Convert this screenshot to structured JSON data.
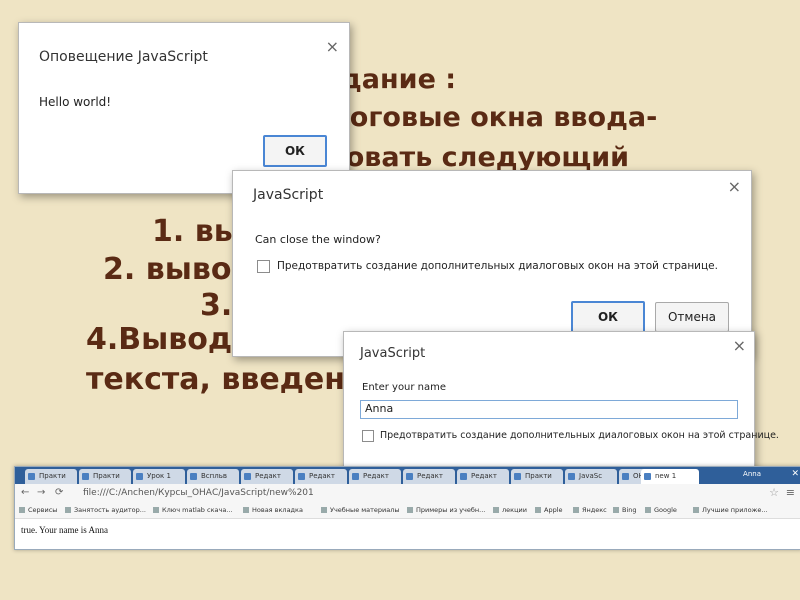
{
  "slide": {
    "line1": "дание :",
    "line2": "логовые окна ввода-",
    "line3": "зовать следующий",
    "line4": "1. вы",
    "line5": "2. выво",
    "line6": "3.",
    "line7": "4.Вывод",
    "line8": "текста, введен"
  },
  "alert_dialog": {
    "title": "Оповещение JavaScript",
    "message": "Hello world!",
    "ok_label": "ОК",
    "close_icon": "×"
  },
  "confirm_dialog": {
    "title": "JavaScript",
    "message": "Can close the window?",
    "checkbox_label": "Предотвратить создание дополнительных диалоговых окон на этой странице.",
    "ok_label": "ОК",
    "cancel_label": "Отмена",
    "close_icon": "×"
  },
  "prompt_dialog": {
    "title": "JavaScript",
    "message": "Enter your name",
    "input_value": "Anna",
    "checkbox_label": "Предотвратить создание дополнительных диалоговых окон на этой странице.",
    "close_icon": "×"
  },
  "browser": {
    "tabs": [
      "Практи",
      "Практи",
      "Урок 1",
      "Вспльв",
      "Редакт",
      "Редакт",
      "Редакт",
      "Редакт",
      "Редакт",
      "Практи",
      "JavaSc",
      "ОНАТ",
      "new 1"
    ],
    "user": "Anna",
    "url": "file:///C:/Anchen/Курсы_ОНАС/JavaScript/new%201",
    "bookmarks": [
      "Сервисы",
      "Занятость аудитор...",
      "Ключ matlab скача...",
      "Новая вкладка",
      "Учебные материалы",
      "Примеры из учебн...",
      "лекции",
      "Apple",
      "Яндекс",
      "Bing",
      "Google",
      "Лучшие приложе..."
    ],
    "page_text": "true. Your name is Anna"
  }
}
